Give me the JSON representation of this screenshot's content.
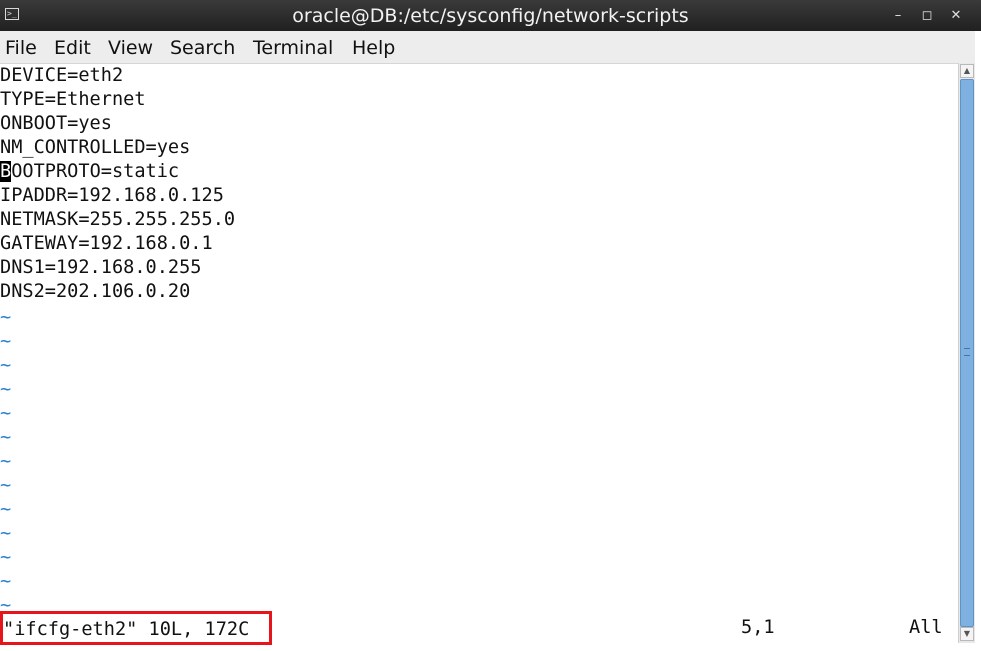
{
  "window": {
    "title": "oracle@DB:/etc/sysconfig/network-scripts",
    "app_icon": "terminal-icon",
    "controls": {
      "minimize": "–",
      "maximize": "◻",
      "close": "✕"
    }
  },
  "menu": {
    "items": [
      "File",
      "Edit",
      "View",
      "Search",
      "Terminal",
      "Help"
    ]
  },
  "editor": {
    "lines": [
      "DEVICE=eth2",
      "TYPE=Ethernet",
      "ONBOOT=yes",
      "NM_CONTROLLED=yes",
      "BOOTPROTO=static",
      "IPADDR=192.168.0.125",
      "NETMASK=255.255.255.0",
      "GATEWAY=192.168.0.1",
      "DNS1=192.168.0.255",
      "DNS2=202.106.0.20"
    ],
    "cursor_char": "B",
    "cursor_line_rest": "OOTPROTO=static",
    "empty_marker": "~"
  },
  "status": {
    "file_info": "\"ifcfg-eth2\" 10L, 172C",
    "position": "5,1",
    "scroll": "All"
  },
  "colors": {
    "tilde": "#2a7fd4",
    "highlight_border": "#e8141c",
    "scroll_thumb": "#7fb1e0"
  }
}
